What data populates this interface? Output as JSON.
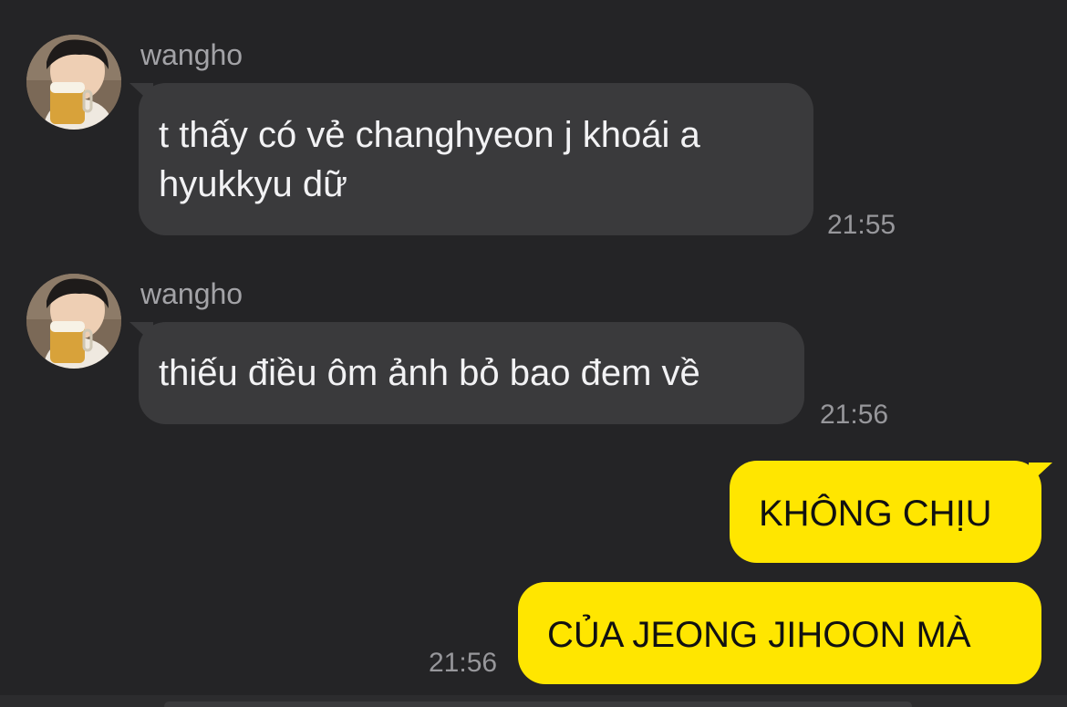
{
  "messages": [
    {
      "sender": "wangho",
      "text_line1": "t thấy có vẻ changhyeon j khoái a",
      "text_line2": "hyukkyu dữ",
      "time": "21:55"
    },
    {
      "sender": "wangho",
      "text": "thiếu điều ôm ảnh bỏ bao đem về",
      "time": "21:56"
    }
  ],
  "outgoing": [
    {
      "text": "KHÔNG CHỊU"
    },
    {
      "text": "CỦA JEONG JIHOON MÀ",
      "time": "21:56"
    }
  ],
  "colors": {
    "background": "#242426",
    "incoming_bubble": "#3a3a3c",
    "outgoing_bubble": "#ffe600"
  },
  "icons": {
    "avatar": "profile-photo-with-beer-mug"
  }
}
